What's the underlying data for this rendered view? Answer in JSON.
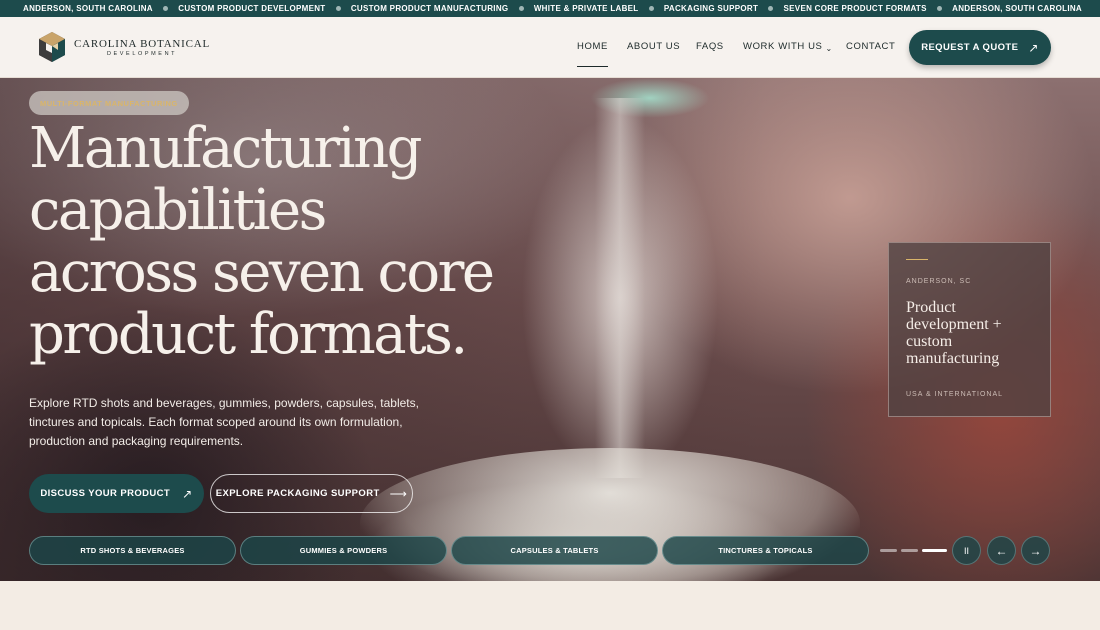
{
  "ticker": {
    "items": [
      "ANDERSON, SOUTH CAROLINA",
      "CUSTOM PRODUCT DEVELOPMENT",
      "CUSTOM PRODUCT MANUFACTURING",
      "WHITE & PRIVATE LABEL",
      "PACKAGING SUPPORT",
      "SEVEN CORE PRODUCT FORMATS",
      "ANDERSON, SOUTH CAROLINA"
    ]
  },
  "brand": {
    "name": "CAROLINA BOTANICAL",
    "sub": "DEVELOPMENT"
  },
  "nav": {
    "home": "HOME",
    "about": "ABOUT US",
    "faqs": "FAQS",
    "work": "WORK WITH US",
    "contact": "CONTACT",
    "chevron": "⌄"
  },
  "header": {
    "quote_label": "REQUEST A QUOTE",
    "quote_arrow": "↗"
  },
  "hero": {
    "tag": "MULTI-FORMAT MANUFACTURING",
    "headline": [
      "Manufacturing",
      "capabilities",
      "across seven core",
      "product formats."
    ],
    "subtext": "Explore RTD shots and beverages, gummies, powders, capsules, tablets, tinctures and topicals. Each format scoped around its own formulation, production and packaging requirements.",
    "primary_label": "DISCUSS YOUR PRODUCT",
    "primary_arrow": "↗",
    "secondary_label": "EXPLORE PACKAGING SUPPORT",
    "secondary_arrow": "⟶"
  },
  "card": {
    "location": "ANDERSON, SC",
    "title": "Product development + custom manufacturing",
    "footer": "USA & INTERNATIONAL"
  },
  "formats": [
    "RTD SHOTS & BEVERAGES",
    "GUMMIES & POWDERS",
    "CAPSULES & TABLETS",
    "TINCTURES & TOPICALS"
  ],
  "slider": {
    "pause": "II",
    "prev": "←",
    "next": "→"
  },
  "colors": {
    "accent": "#1d4b4c",
    "gold": "#d9b56a",
    "header_bg": "#f6f2ee"
  },
  "icons": {
    "logo": "hexagon-cube-logo",
    "arrow_up_right": "arrow-up-right-icon",
    "arrow_right": "arrow-right-icon"
  }
}
